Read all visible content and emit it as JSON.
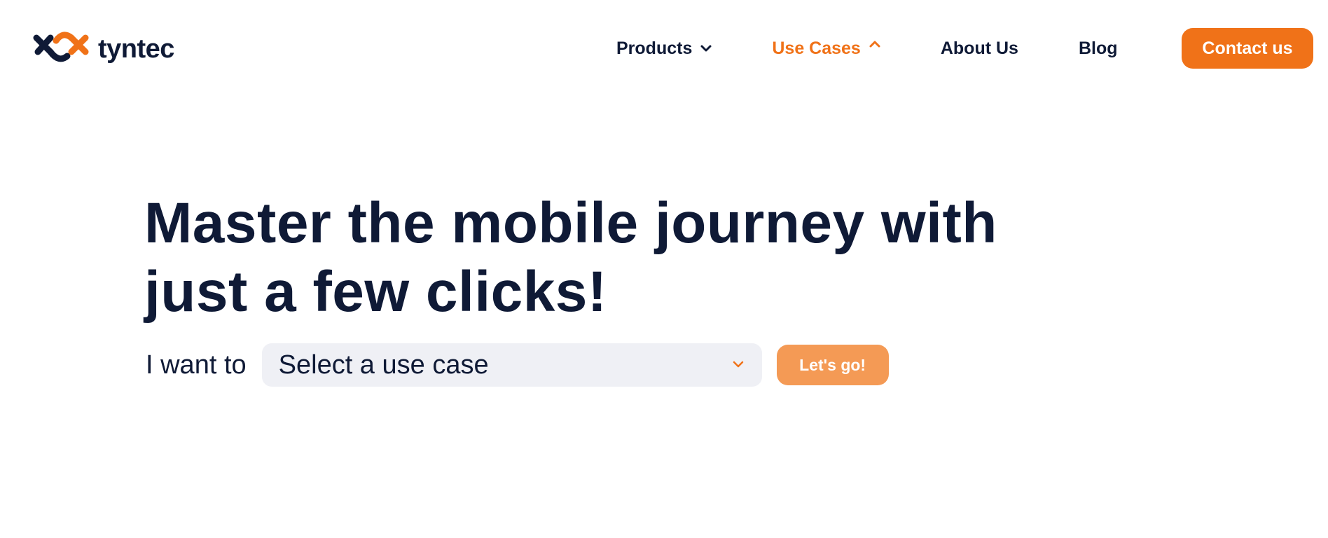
{
  "brand": {
    "name": "tyntec",
    "colors": {
      "navy": "#0f1a36",
      "orange": "#f07218",
      "orange_light": "#f49a55",
      "input_bg": "#eff0f5"
    }
  },
  "nav": {
    "items": [
      {
        "label": "Products",
        "icon": "chevron-down-icon",
        "active": false
      },
      {
        "label": "Use Cases",
        "icon": "chevron-up-icon",
        "active": true
      },
      {
        "label": "About Us"
      },
      {
        "label": "Blog"
      }
    ],
    "cta_label": "Contact us"
  },
  "hero": {
    "title_line1": "Master the mobile journey with",
    "title_line2": "just a few clicks!",
    "form": {
      "label": "I want to",
      "select_value": "Select a use case",
      "select_icon": "chevron-down-icon",
      "submit_label": "Let's go!"
    }
  }
}
